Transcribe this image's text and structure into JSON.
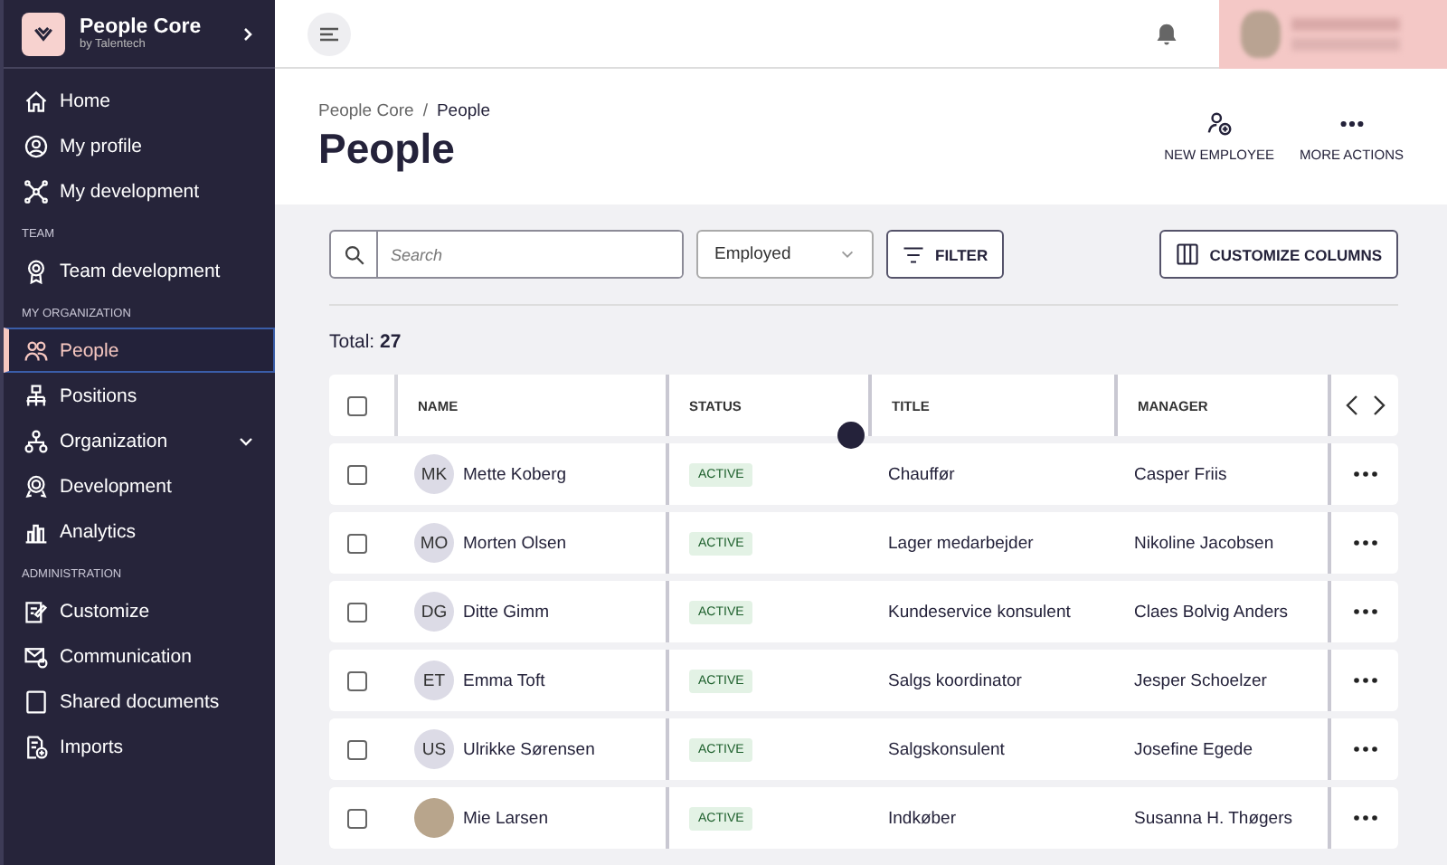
{
  "sidebar": {
    "brand": {
      "title": "People Core",
      "subtitle": "by Talentech"
    },
    "sections": [
      {
        "items": [
          {
            "label": "Home",
            "selected": false,
            "kind": "link"
          },
          {
            "label": "My profile",
            "selected": false,
            "kind": "link"
          },
          {
            "label": "My development",
            "selected": false,
            "kind": "link"
          }
        ]
      },
      {
        "heading": "TEAM",
        "items": [
          {
            "label": "Team development",
            "selected": false,
            "kind": "link"
          }
        ]
      },
      {
        "heading": "MY ORGANIZATION",
        "items": [
          {
            "label": "People",
            "selected": true,
            "kind": "link"
          },
          {
            "label": "Positions",
            "selected": false,
            "kind": "link"
          },
          {
            "label": "Organization",
            "selected": false,
            "kind": "group"
          },
          {
            "label": "Development",
            "selected": false,
            "kind": "link"
          },
          {
            "label": "Analytics",
            "selected": false,
            "kind": "link"
          }
        ]
      },
      {
        "heading": "ADMINISTRATION",
        "items": [
          {
            "label": "Customize",
            "selected": false,
            "kind": "link"
          },
          {
            "label": "Communication",
            "selected": false,
            "kind": "link"
          },
          {
            "label": "Shared documents",
            "selected": false,
            "kind": "link"
          },
          {
            "label": "Imports",
            "selected": false,
            "kind": "link"
          }
        ]
      }
    ]
  },
  "header": {
    "breadcrumbs": [
      "People Core",
      "People"
    ],
    "breadcrumb_separator": "/",
    "title": "People",
    "actions": [
      {
        "label": "NEW EMPLOYEE"
      },
      {
        "label": "MORE ACTIONS"
      }
    ]
  },
  "toolbar": {
    "search": {
      "placeholder": "Search"
    },
    "status_select": {
      "value": "Employed"
    },
    "filter_button": "FILTER",
    "customize_button": "CUSTOMIZE COLUMNS"
  },
  "total": {
    "label": "Total:",
    "count": "27"
  },
  "table": {
    "select_all_checked": false,
    "columns": [
      "NAME",
      "STATUS",
      "TITLE",
      "MANAGER"
    ],
    "rows": [
      {
        "checked": false,
        "kind": "initials",
        "initials": "MK",
        "name": "Mette Koberg",
        "status": "ACTIVE",
        "title": "Chauffør",
        "manager": "Casper Friis"
      },
      {
        "checked": false,
        "kind": "initials",
        "initials": "MO",
        "name": "Morten Olsen",
        "status": "ACTIVE",
        "title": "Lager medarbejder",
        "manager": "Nikoline Jacobsen"
      },
      {
        "checked": false,
        "kind": "initials",
        "initials": "DG",
        "name": "Ditte Gimm",
        "status": "ACTIVE",
        "title": "Kundeservice konsulent",
        "manager": "Claes Bolvig Anders"
      },
      {
        "checked": false,
        "kind": "initials",
        "initials": "ET",
        "name": "Emma Toft",
        "status": "ACTIVE",
        "title": "Salgs koordinator",
        "manager": "Jesper Schoelzer"
      },
      {
        "checked": false,
        "kind": "initials",
        "initials": "US",
        "name": "Ulrikke Sørensen",
        "status": "ACTIVE",
        "title": "Salgskonsulent",
        "manager": "Josefine Egede"
      },
      {
        "checked": false,
        "kind": "photo",
        "name": "Mie Larsen",
        "status": "ACTIVE",
        "title": "Indkøber",
        "manager": "Susanna H. Thøgers"
      }
    ]
  }
}
